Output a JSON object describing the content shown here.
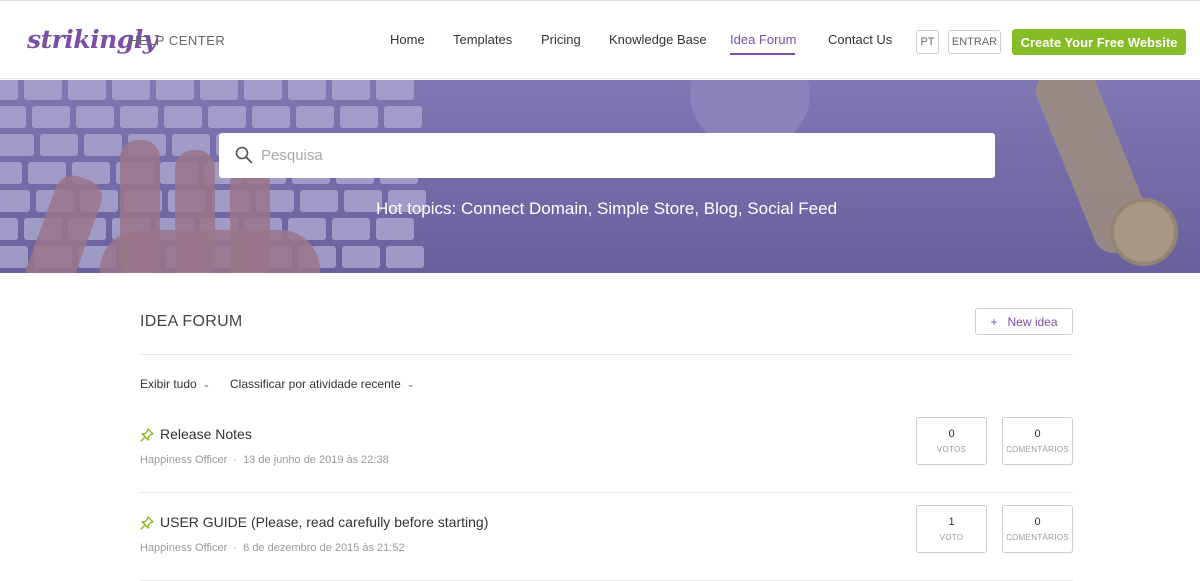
{
  "brand": {
    "logo": "strikingly",
    "help_center": "HELP CENTER",
    "accent": "#7b4fa6",
    "cta_color": "#86bc26"
  },
  "nav": {
    "items": [
      {
        "label": "Home"
      },
      {
        "label": "Templates"
      },
      {
        "label": "Pricing"
      },
      {
        "label": "Knowledge Base"
      },
      {
        "label": "Idea Forum",
        "active": true
      },
      {
        "label": "Contact Us"
      }
    ],
    "lang": "PT",
    "login": "ENTRAR",
    "cta": "Create Your Free Website"
  },
  "hero": {
    "search_placeholder": "Pesquisa",
    "search_icon": "search-icon",
    "hot_topics": "Hot topics: Connect Domain, Simple Store, Blog, Social Feed"
  },
  "forum": {
    "title": "IDEA FORUM",
    "new_idea": "New idea",
    "new_idea_icon": "+",
    "filters": {
      "show": "Exibir tudo",
      "sort": "Classificar por atividade recente"
    },
    "posts": [
      {
        "title": "Release Notes",
        "author": "Happiness Officer",
        "date": "13 de junho de 2019 às 22:38",
        "votes": "0",
        "votes_label": "VOTOS",
        "comments": "0",
        "comments_label": "COMENTÁRIOS"
      },
      {
        "title": "USER GUIDE (Please, read carefully before starting)",
        "author": "Happiness Officer",
        "date": "6 de dezembro de 2015 às 21:52",
        "votes": "1",
        "votes_label": "VOTO",
        "comments": "0",
        "comments_label": "COMENTÁRIOS"
      }
    ]
  }
}
